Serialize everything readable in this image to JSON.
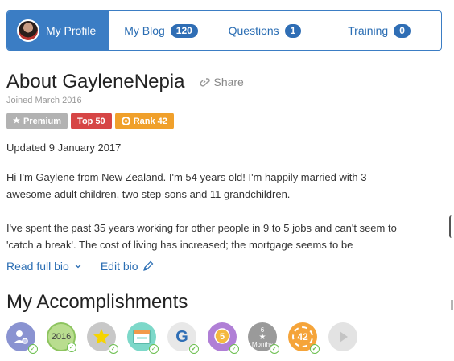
{
  "tabs": [
    {
      "label": "My Profile",
      "active": true
    },
    {
      "label": "My Blog",
      "count": "120"
    },
    {
      "label": "Questions",
      "count": "1"
    },
    {
      "label": "Training",
      "count": "0"
    }
  ],
  "profile": {
    "title": "About GayleneNepia",
    "share_label": "Share",
    "joined": "Joined March 2016",
    "badges": {
      "premium": "Premium",
      "top": "Top 50",
      "rank": "Rank 42"
    }
  },
  "bio": {
    "updated": "Updated 9 January 2017",
    "paragraph1_line1": "Hi I'm Gaylene from New Zealand. I'm 54 years old! I'm happily married with 3",
    "paragraph1_line2": "awesome adult children, two step-sons and 11 grandchildren.",
    "paragraph2_line1": "I've spent the past 35 years working for other people in 9 to 5 jobs and can't seem to",
    "paragraph2_line2": "'catch a break'. The cost of living has increased; the mortgage seems to be",
    "read_full_label": "Read full bio",
    "edit_label": "Edit bio"
  },
  "accomplishments": {
    "title": "My Accomplishments",
    "items": [
      {
        "name": "user-settings"
      },
      {
        "name": "year",
        "text": "2016"
      },
      {
        "name": "star"
      },
      {
        "name": "website"
      },
      {
        "name": "google",
        "text": "G"
      },
      {
        "name": "5-award",
        "text": "5"
      },
      {
        "name": "months",
        "text_top": "6",
        "text_bottom": "Months"
      },
      {
        "name": "rank",
        "text": "42"
      },
      {
        "name": "play"
      }
    ]
  },
  "colors": {
    "accent": "#3b7dc4",
    "premium": "#b2b2b2",
    "top": "#d64545",
    "rank": "#f0a02b"
  }
}
